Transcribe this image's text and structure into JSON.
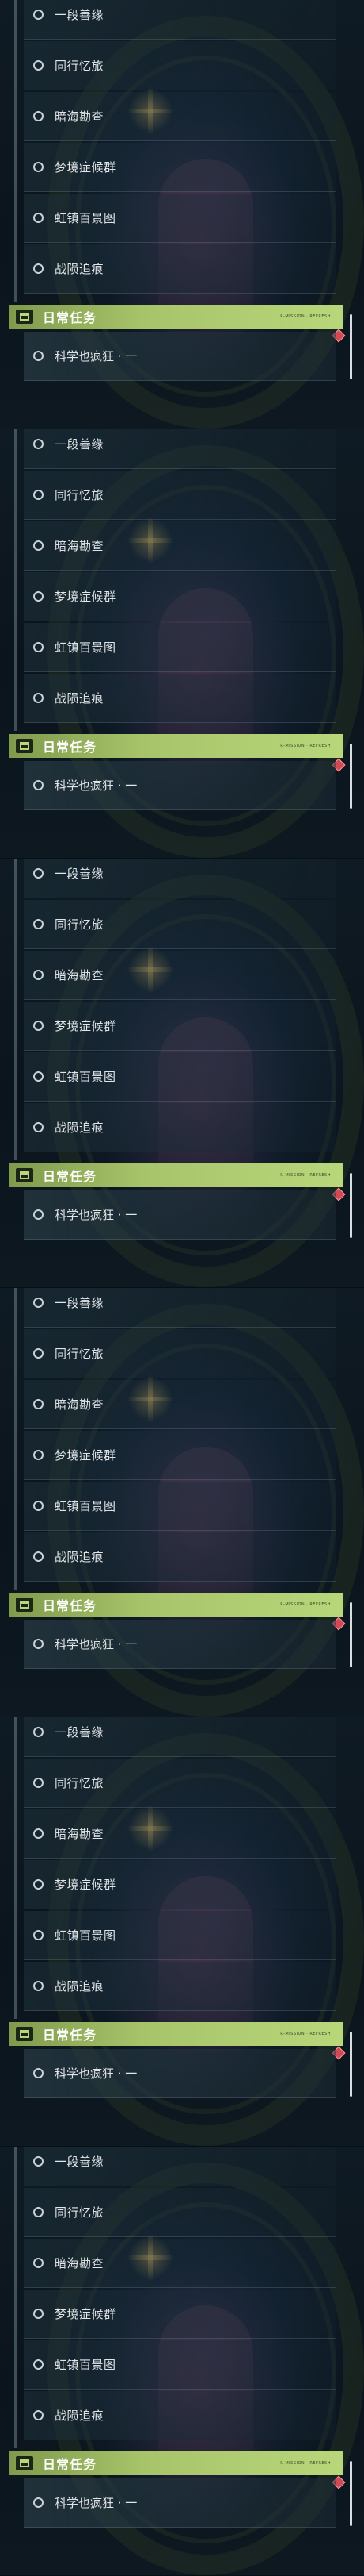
{
  "panels": [
    {
      "items": [
        {
          "label": "一段善缘"
        },
        {
          "label": "同行忆旅"
        },
        {
          "label": "暗海勘查"
        },
        {
          "label": "梦境症候群"
        },
        {
          "label": "虹镇百景图"
        },
        {
          "label": "战陨追痕"
        }
      ],
      "daily": {
        "title": "日常任务",
        "meta": "R-MISSION · REFRESH",
        "item": "科学也疯狂 · 一"
      }
    },
    {
      "items": [
        {
          "label": "一段善缘"
        },
        {
          "label": "同行忆旅"
        },
        {
          "label": "暗海勘查"
        },
        {
          "label": "梦境症候群"
        },
        {
          "label": "虹镇百景图"
        },
        {
          "label": "战陨追痕"
        }
      ],
      "daily": {
        "title": "日常任务",
        "meta": "R-MISSION · REFRESH",
        "item": "科学也疯狂 · 一"
      }
    },
    {
      "items": [
        {
          "label": "一段善缘"
        },
        {
          "label": "同行忆旅"
        },
        {
          "label": "暗海勘查"
        },
        {
          "label": "梦境症候群"
        },
        {
          "label": "虹镇百景图"
        },
        {
          "label": "战陨追痕"
        }
      ],
      "daily": {
        "title": "日常任务",
        "meta": "R-MISSION · REFRESH",
        "item": "科学也疯狂 · 一"
      }
    },
    {
      "items": [
        {
          "label": "一段善缘"
        },
        {
          "label": "同行忆旅"
        },
        {
          "label": "暗海勘查"
        },
        {
          "label": "梦境症候群"
        },
        {
          "label": "虹镇百景图"
        },
        {
          "label": "战陨追痕"
        }
      ],
      "daily": {
        "title": "日常任务",
        "meta": "R-MISSION · REFRESH",
        "item": "科学也疯狂 · 一"
      }
    },
    {
      "items": [
        {
          "label": "一段善缘"
        },
        {
          "label": "同行忆旅"
        },
        {
          "label": "暗海勘查"
        },
        {
          "label": "梦境症候群"
        },
        {
          "label": "虹镇百景图"
        },
        {
          "label": "战陨追痕"
        }
      ],
      "daily": {
        "title": "日常任务",
        "meta": "R-MISSION · REFRESH",
        "item": "科学也疯狂 · 一"
      }
    },
    {
      "items": [
        {
          "label": "一段善缘"
        },
        {
          "label": "同行忆旅"
        },
        {
          "label": "暗海勘查"
        },
        {
          "label": "梦境症候群"
        },
        {
          "label": "虹镇百景图"
        },
        {
          "label": "战陨追痕"
        }
      ],
      "daily": {
        "title": "日常任务",
        "meta": "R-MISSION · REFRESH",
        "item": "科学也疯狂 · 一"
      }
    }
  ],
  "icons": {
    "radio": "radio-circle-icon",
    "calendar": "calendar-icon",
    "alert": "red-diamond-icon"
  },
  "colors": {
    "daily_header": "#a7c46a",
    "alert": "#d04a55"
  }
}
